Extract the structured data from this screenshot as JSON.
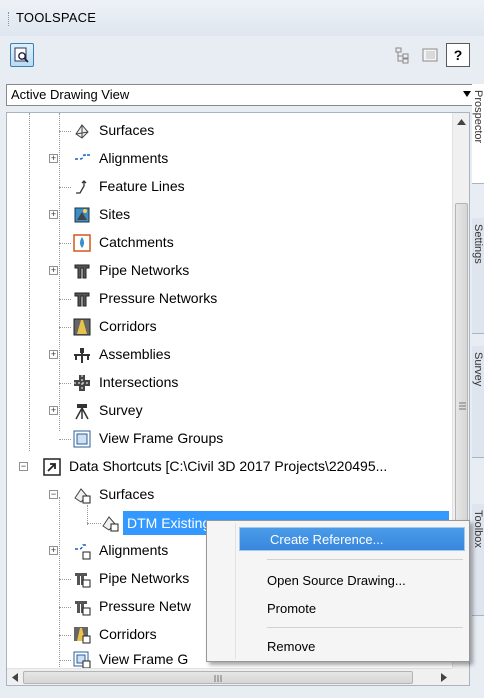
{
  "panel": {
    "title": "TOOLSPACE"
  },
  "toolbar": {
    "help_label": "?"
  },
  "view_select": {
    "value": "Active Drawing View"
  },
  "tree": {
    "items": [
      {
        "label": "Surfaces"
      },
      {
        "label": "Alignments"
      },
      {
        "label": "Feature Lines"
      },
      {
        "label": "Sites"
      },
      {
        "label": "Catchments"
      },
      {
        "label": "Pipe Networks"
      },
      {
        "label": "Pressure Networks"
      },
      {
        "label": "Corridors"
      },
      {
        "label": "Assemblies"
      },
      {
        "label": "Intersections"
      },
      {
        "label": "Survey"
      },
      {
        "label": "View Frame Groups"
      },
      {
        "label": "Data Shortcuts [C:\\Civil 3D 2017 Projects\\220495..."
      },
      {
        "label": "Surfaces"
      },
      {
        "label": "DTM Existing"
      },
      {
        "label": "Alignments"
      },
      {
        "label": "Pipe Networks"
      },
      {
        "label": "Pressure Netw"
      },
      {
        "label": "Corridors"
      },
      {
        "label": "View Frame G"
      }
    ]
  },
  "side_tabs": [
    "Prospector",
    "Settings",
    "Survey",
    "Toolbox"
  ],
  "context_menu": {
    "items": [
      {
        "label": "Create Reference..."
      },
      {
        "label": "Open Source Drawing..."
      },
      {
        "label": "Promote"
      },
      {
        "label": "Remove"
      }
    ]
  },
  "colors": {
    "selection": "#3399ff",
    "menu_hover": "#3887de"
  }
}
